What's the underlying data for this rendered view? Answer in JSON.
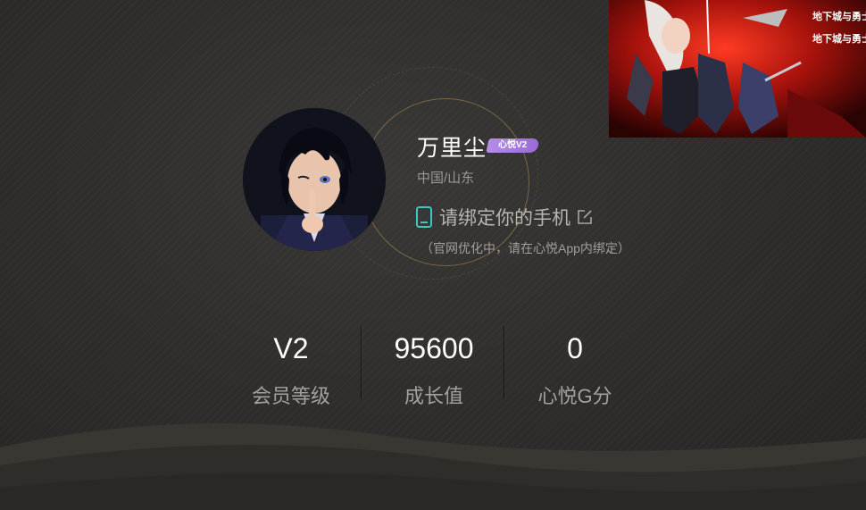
{
  "profile": {
    "username": "万里尘",
    "level_badge": "心悦V2",
    "location": "中国/山东",
    "bind_phone_text": "请绑定你的手机",
    "bind_note": "（官网优化中，请在心悦App内绑定）"
  },
  "stats": [
    {
      "value": "V2",
      "label": "会员等级"
    },
    {
      "value": "95600",
      "label": "成长值"
    },
    {
      "value": "0",
      "label": "心悦G分"
    }
  ],
  "game_thumbnail": {
    "logo_text": "地下城与勇士",
    "logo_text_2": "地下城与勇士"
  },
  "icons": {
    "phone": "phone-icon",
    "edit": "edit-icon"
  },
  "colors": {
    "badge": "#a878e0",
    "phone_icon": "#3cc7c2",
    "accent_ring": "#c8965a"
  }
}
